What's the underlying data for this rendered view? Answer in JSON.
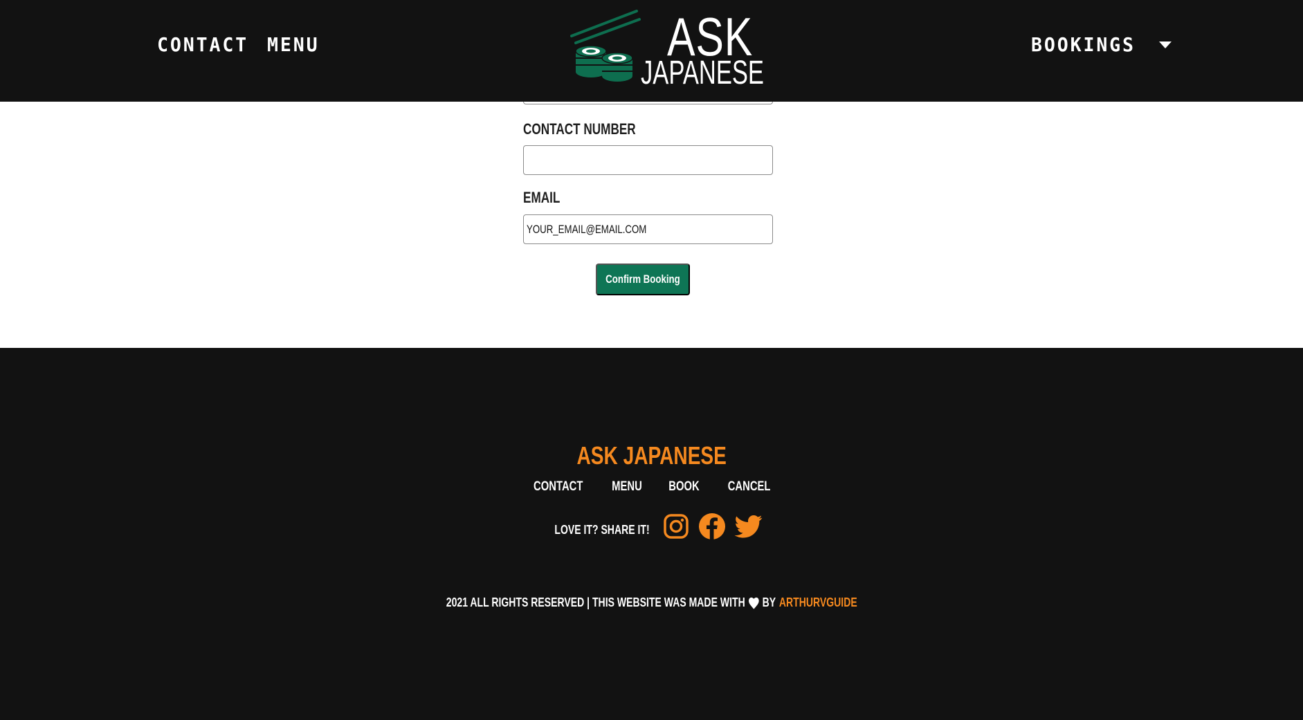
{
  "nav": {
    "contact_label": "CONTACT",
    "menu_label": "MENU",
    "bookings_label": "BOOKINGS"
  },
  "logo": {
    "line1": "ASK",
    "line2": "JAPANESE"
  },
  "form": {
    "contact_number_label": "Contact Number",
    "contact_number_value": "",
    "email_label": "Email",
    "email_value": "YOUR_EMAIL@EMAIL.COM",
    "confirm_label": "Confirm Booking"
  },
  "footer": {
    "brand": "ASK JAPANESE",
    "links": [
      "CONTACT",
      "MENU",
      "BOOK",
      "CANCEL"
    ],
    "share_text": "LOVE IT? SHARE IT!",
    "copyright_prefix": "2021 ALL RIGHTS RESERVED | THIS WEBSITE WAS MADE WITH",
    "copyright_by": "BY",
    "author": "ARTHURVGUIDE"
  },
  "colors": {
    "background_dark": "#121212",
    "accent_orange": "#f5891f",
    "button_green": "#0e7555",
    "logo_green": "#0e6e4f"
  },
  "icons": [
    "chopsticks-sushi-logo-icon",
    "caret-down-icon",
    "instagram-icon",
    "facebook-icon",
    "twitter-icon",
    "heart-icon"
  ]
}
